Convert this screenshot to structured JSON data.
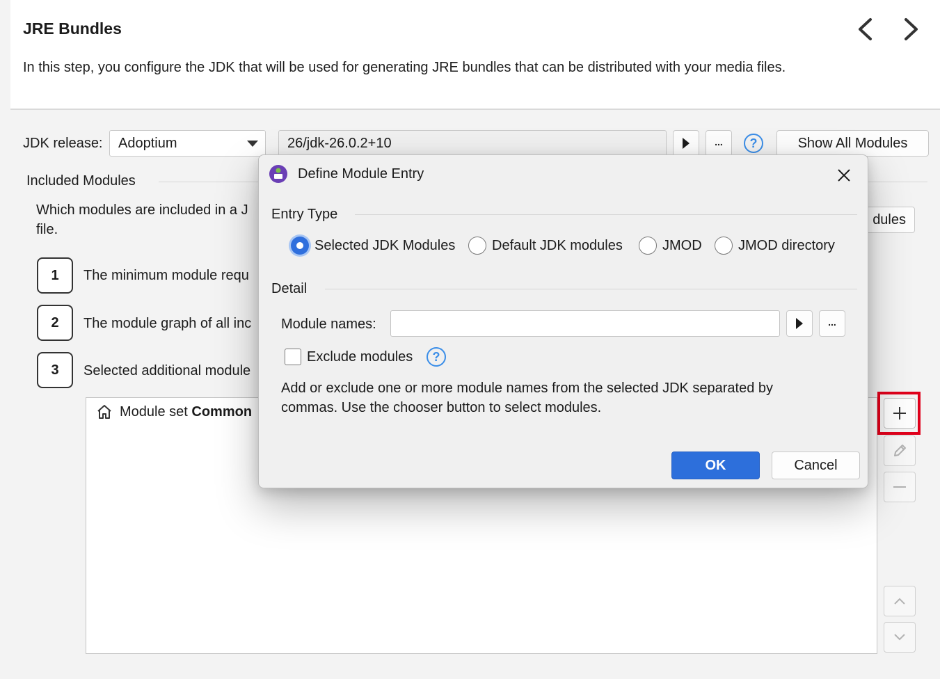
{
  "header": {
    "title": "JRE Bundles",
    "description": "In this step, you configure the JDK that will be used for generating JRE bundles that can be distributed with your media files."
  },
  "jdk": {
    "label": "JDK release:",
    "provider": "Adoptium",
    "version": "26/jdk-26.0.2+10",
    "browse_label": "...",
    "show_all_label": "Show All Modules"
  },
  "included": {
    "title": "Included Modules",
    "question_line1": "Which modules are included in a J",
    "question_line2": "file.",
    "partial_button_label": "dules",
    "items": [
      {
        "num": "1",
        "text": "The minimum module requ"
      },
      {
        "num": "2",
        "text": "The module graph of all inc"
      },
      {
        "num": "3",
        "text": "Selected additional module"
      }
    ],
    "list_item_prefix": "Module set ",
    "list_item_bold": "Common"
  },
  "dialog": {
    "title": "Define Module Entry",
    "entry_type_label": "Entry Type",
    "options": [
      "Selected JDK Modules",
      "Default JDK modules",
      "JMOD",
      "JMOD directory"
    ],
    "selected_option": "Selected JDK Modules",
    "detail_label": "Detail",
    "module_names_label": "Module names:",
    "module_names_value": "",
    "browse_label": "...",
    "exclude_label": "Exclude modules",
    "exclude_checked": false,
    "help_line1": "Add or exclude one or more module names from the selected JDK separated by",
    "help_line2": "commas. Use the chooser button to select modules.",
    "ok_label": "OK",
    "cancel_label": "Cancel"
  },
  "colors": {
    "accent": "#2d6fdb",
    "highlight": "#e0001b",
    "help_icon": "#3b8ee8",
    "dialog_icon": "#6a3fb5"
  }
}
